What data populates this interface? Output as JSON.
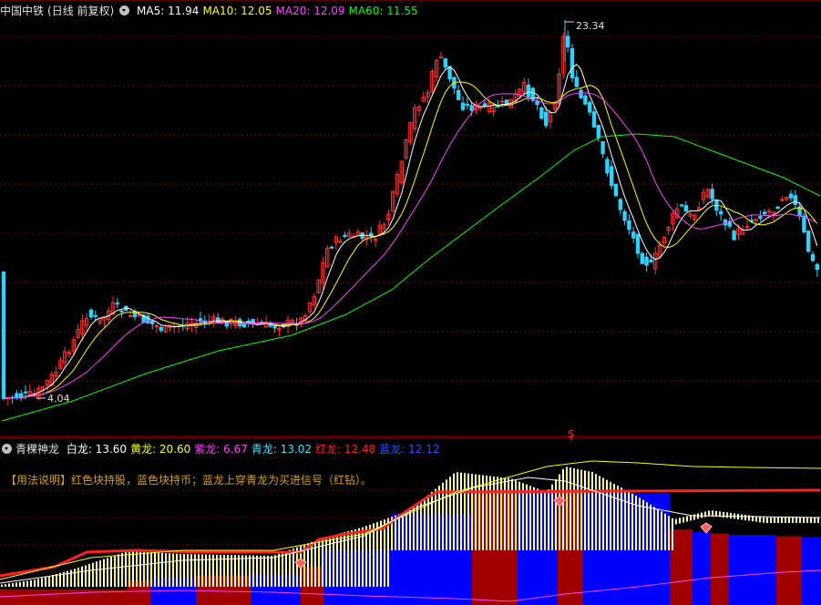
{
  "main": {
    "title": "中国中铁",
    "period": "(日线 前复权)",
    "ma": [
      {
        "label": "MA5:",
        "value": "11.94",
        "color": "#ffffff"
      },
      {
        "label": "MA10:",
        "value": "12.05",
        "color": "#ffff00"
      },
      {
        "label": "MA20:",
        "value": "12.09",
        "color": "#ff40ff"
      },
      {
        "label": "MA60:",
        "value": "11.55",
        "color": "#00ff00"
      }
    ],
    "high_label": "23.34",
    "low_label": "4.04",
    "signal_mark": "S"
  },
  "indicator": {
    "title": "青稞神龙",
    "lines": [
      {
        "label": "白龙:",
        "value": "13.60",
        "color": "#ffffff"
      },
      {
        "label": "黄龙:",
        "value": "20.60",
        "color": "#ffff00"
      },
      {
        "label": "紫龙:",
        "value": "6.67",
        "color": "#ff40ff"
      },
      {
        "label": "青龙:",
        "value": "13.02",
        "color": "#40e0ff"
      },
      {
        "label": "红龙:",
        "value": "12.48",
        "color": "#ff2020"
      },
      {
        "label": "蓝龙:",
        "value": "12.12",
        "color": "#3050ff"
      }
    ],
    "usage_note": "【用法说明】红色块持股，蓝色块持币；蓝龙上穿青龙为买进信号（红钻）。"
  },
  "colors": {
    "up": "#ff3030",
    "down": "#30d0ff",
    "grid": "#7a0000",
    "border": "#a00000"
  }
}
